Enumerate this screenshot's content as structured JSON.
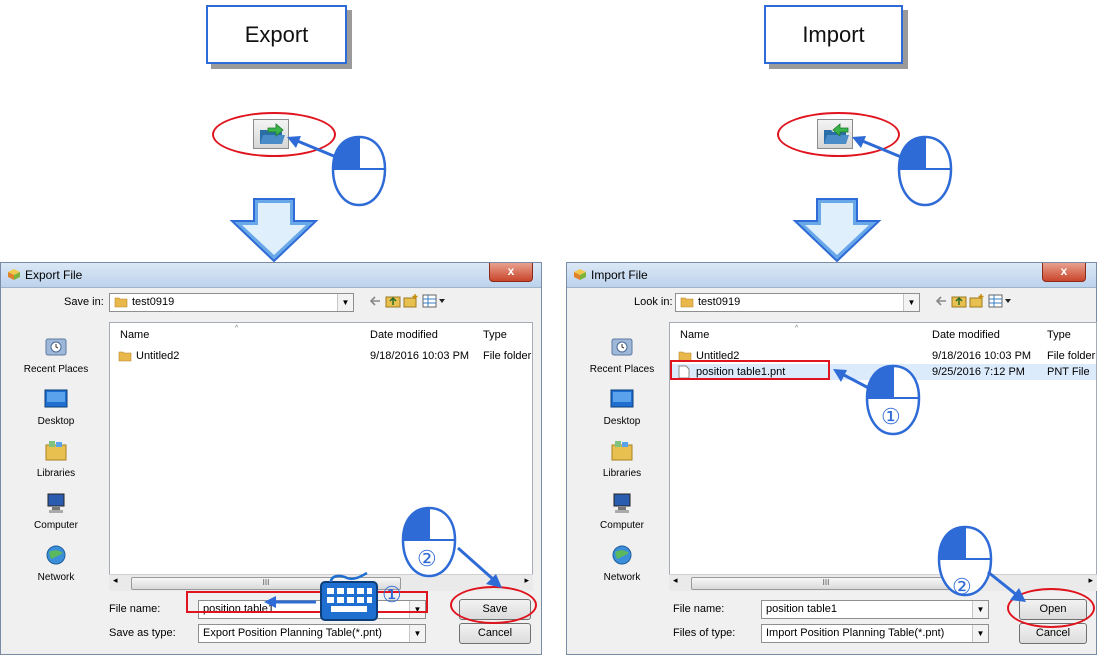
{
  "export_panel": {
    "callout": "Export",
    "dialog": {
      "title": "Export File",
      "location_label": "Save in:",
      "location_value": "test0919",
      "columns": [
        "Name",
        "Date modified",
        "Type"
      ],
      "rows": [
        {
          "name": "Untitled2",
          "date": "9/18/2016 10:03 PM",
          "type": "File folder"
        }
      ],
      "places": [
        "Recent Places",
        "Desktop",
        "Libraries",
        "Computer",
        "Network"
      ],
      "file_name_label": "File name:",
      "file_name_value": "position table1",
      "file_type_label": "Save as type:",
      "file_type_value": "Export Position Planning Table(*.pnt)",
      "primary_button": "Save",
      "cancel_button": "Cancel"
    },
    "step_marks": [
      "①",
      "②"
    ]
  },
  "import_panel": {
    "callout": "Import",
    "dialog": {
      "title": "Import File",
      "location_label": "Look in:",
      "location_value": "test0919",
      "columns": [
        "Name",
        "Date modified",
        "Type"
      ],
      "rows": [
        {
          "name": "Untitled2",
          "date": "9/18/2016 10:03 PM",
          "type": "File folder"
        },
        {
          "name": "position table1.pnt",
          "date": "9/25/2016 7:12 PM",
          "type": "PNT File"
        }
      ],
      "places": [
        "Recent Places",
        "Desktop",
        "Libraries",
        "Computer",
        "Network"
      ],
      "file_name_label": "File name:",
      "file_name_value": "position table1",
      "file_type_label": "Files of type:",
      "file_type_value": "Import Position Planning Table(*.pnt)",
      "primary_button": "Open",
      "cancel_button": "Cancel"
    },
    "step_marks": [
      "①",
      "②"
    ]
  },
  "colors": {
    "accent_blue": "#2e6bd6",
    "highlight_red": "#e0141e",
    "arrow_fill": "#69a8e8"
  },
  "icons": [
    "export-folder-icon",
    "import-folder-icon",
    "mouse-icon",
    "keyboard-icon",
    "down-arrow-icon",
    "folder-icon",
    "file-icon"
  ]
}
